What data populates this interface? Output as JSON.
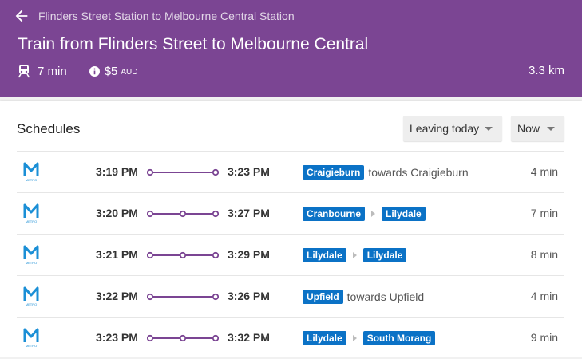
{
  "header": {
    "breadcrumb": "Flinders Street Station to Melbourne Central Station",
    "title": "Train from Flinders Street to Melbourne Central",
    "duration": "7 min",
    "fare": "$5",
    "currency": "AUD",
    "distance": "3.3 km"
  },
  "schedules": {
    "title": "Schedules",
    "day_filter": "Leaving today",
    "time_filter": "Now",
    "logo_text": "METRO",
    "rows": [
      {
        "depart": "3:19 PM",
        "arrive": "3:23 PM",
        "stops": 2,
        "route": [
          "Craigieburn"
        ],
        "towards": "towards Craigieburn",
        "duration": "4 min"
      },
      {
        "depart": "3:20 PM",
        "arrive": "3:27 PM",
        "stops": 3,
        "route": [
          "Cranbourne",
          "Lilydale"
        ],
        "towards": "",
        "duration": "7 min"
      },
      {
        "depart": "3:21 PM",
        "arrive": "3:29 PM",
        "stops": 3,
        "route": [
          "Lilydale",
          "Lilydale"
        ],
        "towards": "",
        "duration": "8 min"
      },
      {
        "depart": "3:22 PM",
        "arrive": "3:26 PM",
        "stops": 2,
        "route": [
          "Upfield"
        ],
        "towards": "towards Upfield",
        "duration": "4 min"
      },
      {
        "depart": "3:23 PM",
        "arrive": "3:32 PM",
        "stops": 3,
        "route": [
          "Lilydale",
          "South Morang"
        ],
        "towards": "",
        "duration": "9 min"
      }
    ]
  },
  "colors": {
    "header_bg": "#7b4593",
    "route_badge": "#0b72c6",
    "timeline": "#7b4593",
    "metro_logo": "#1b8fd6"
  },
  "icons": {
    "back": "arrow-left-icon",
    "mode": "train-icon",
    "fare": "info-icon",
    "operator": "metro-logo-icon",
    "dropdown": "caret-down-icon",
    "route_separator": "chevron-right-icon"
  }
}
